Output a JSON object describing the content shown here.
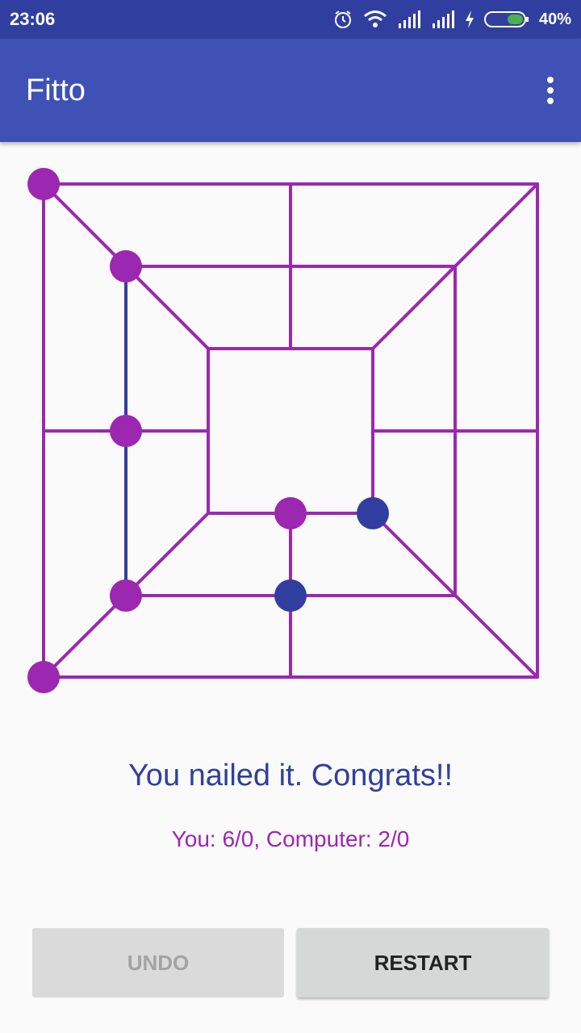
{
  "status_bar": {
    "time": "23:06",
    "battery_percent": "40%",
    "icons": [
      "alarm-icon",
      "wifi-icon",
      "signal-icon",
      "signal-icon",
      "charging-icon",
      "battery-icon"
    ]
  },
  "app_bar": {
    "title": "Fitto",
    "menu_icon": "more-vert-icon"
  },
  "board": {
    "line_color": "#9c27b0",
    "player_color": "#9c27b0",
    "computer_color": "#303f9f",
    "player_pieces": [
      "a7",
      "b6",
      "b4",
      "d3",
      "b2",
      "a1"
    ],
    "computer_pieces": [
      "e3",
      "d2"
    ],
    "mill_highlight": [
      "b6",
      "b4",
      "b2"
    ]
  },
  "message": "You nailed it. Congrats!!",
  "score": "You: 6/0, Computer: 2/0",
  "buttons": {
    "undo": "UNDO",
    "undo_enabled": false,
    "restart": "RESTART"
  }
}
